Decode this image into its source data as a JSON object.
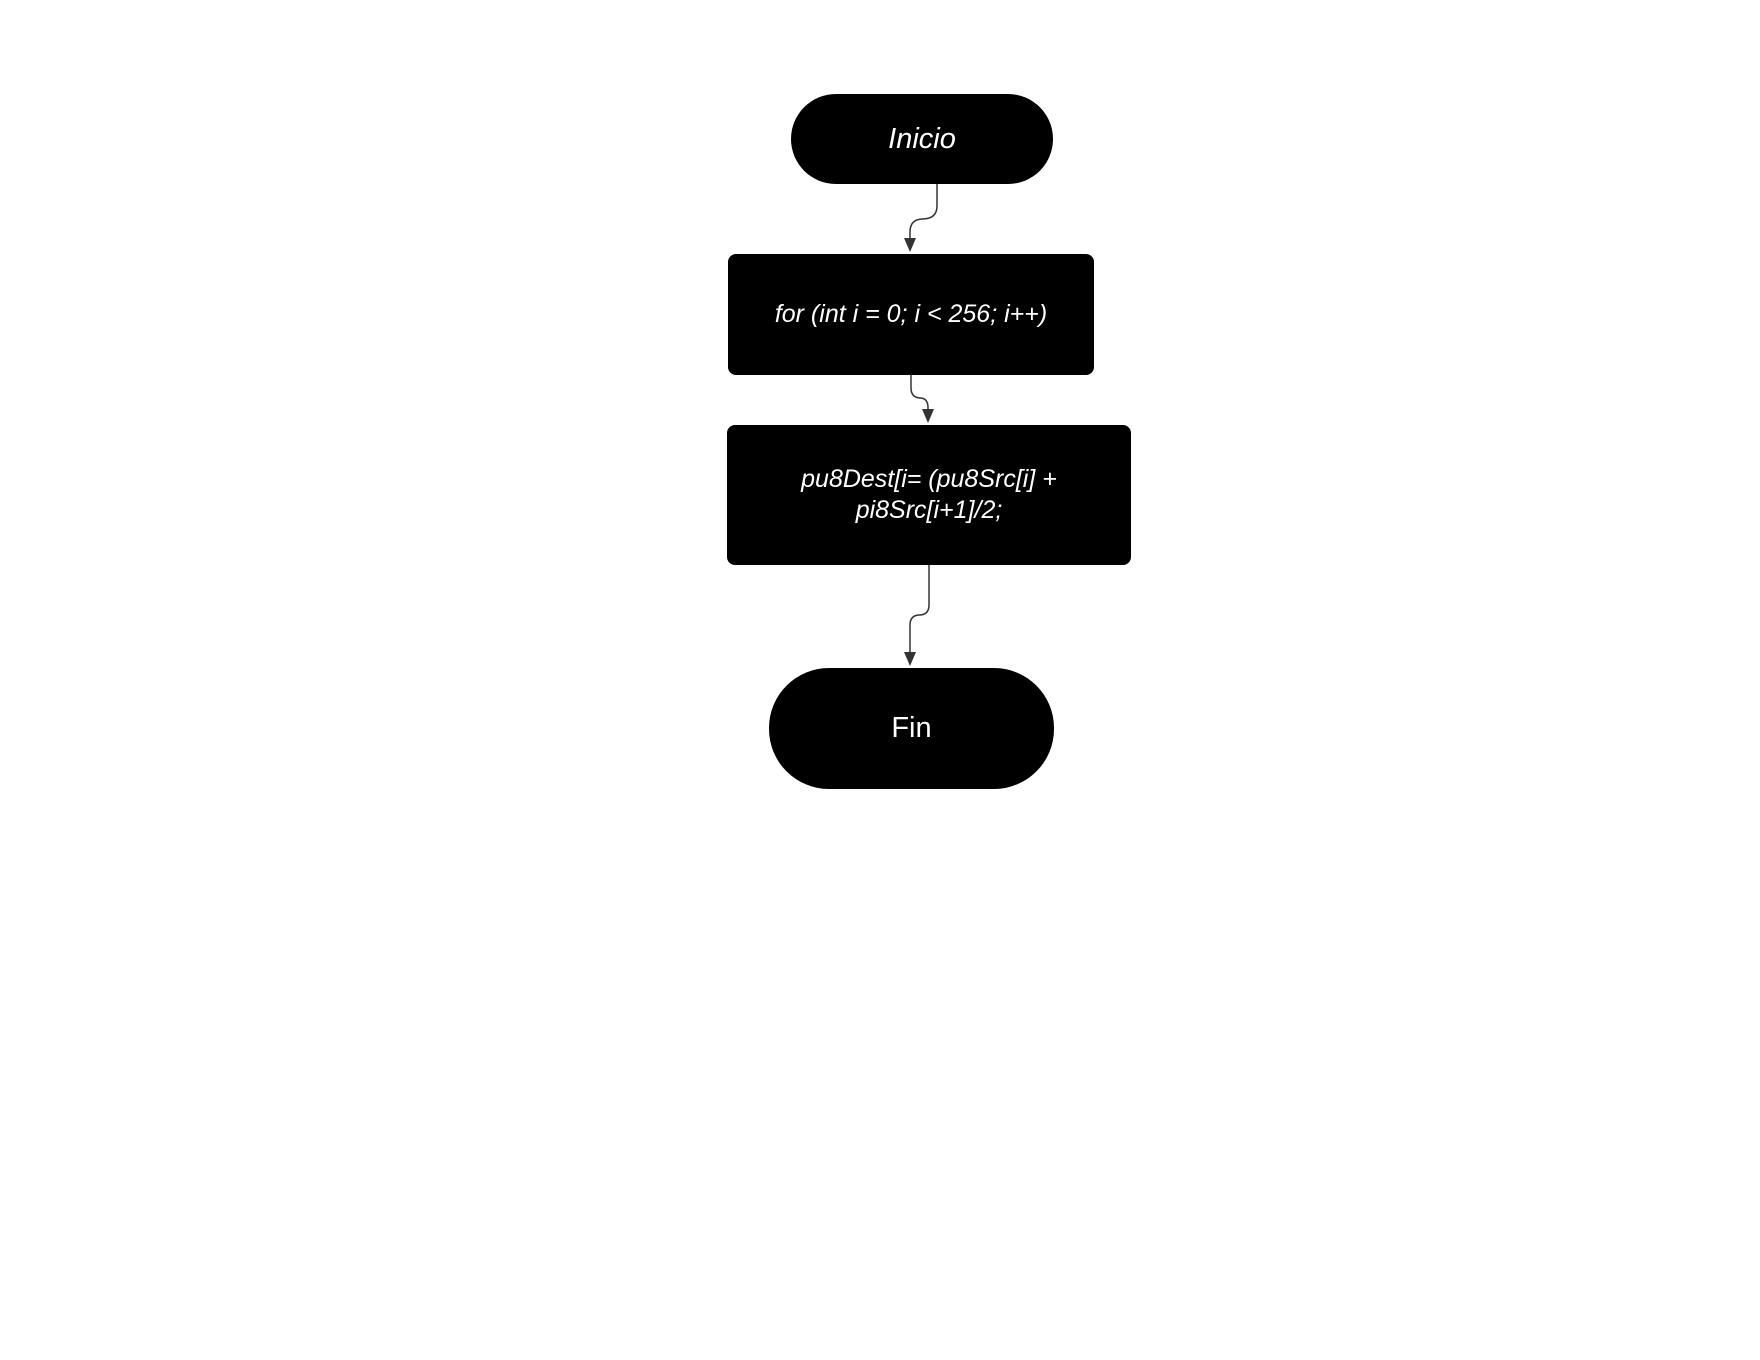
{
  "diagram": {
    "type": "flowchart",
    "nodes": [
      {
        "id": "start",
        "shape": "terminal",
        "label": "Inicio"
      },
      {
        "id": "loop",
        "shape": "process",
        "label": "for (int i = 0; i < 256; i++)"
      },
      {
        "id": "process",
        "shape": "process",
        "label_lines": [
          "pu8Dest[i= (pu8Src[i] +",
          "pi8Src[i+1]/2;"
        ]
      },
      {
        "id": "end",
        "shape": "terminal",
        "label": "Fin"
      }
    ],
    "edges": [
      {
        "from": "start",
        "to": "loop"
      },
      {
        "from": "loop",
        "to": "process"
      },
      {
        "from": "process",
        "to": "end"
      }
    ],
    "colors": {
      "node_fill": "#000000",
      "node_text": "#ffffff",
      "connector": "#333333",
      "background": "#ffffff"
    }
  }
}
